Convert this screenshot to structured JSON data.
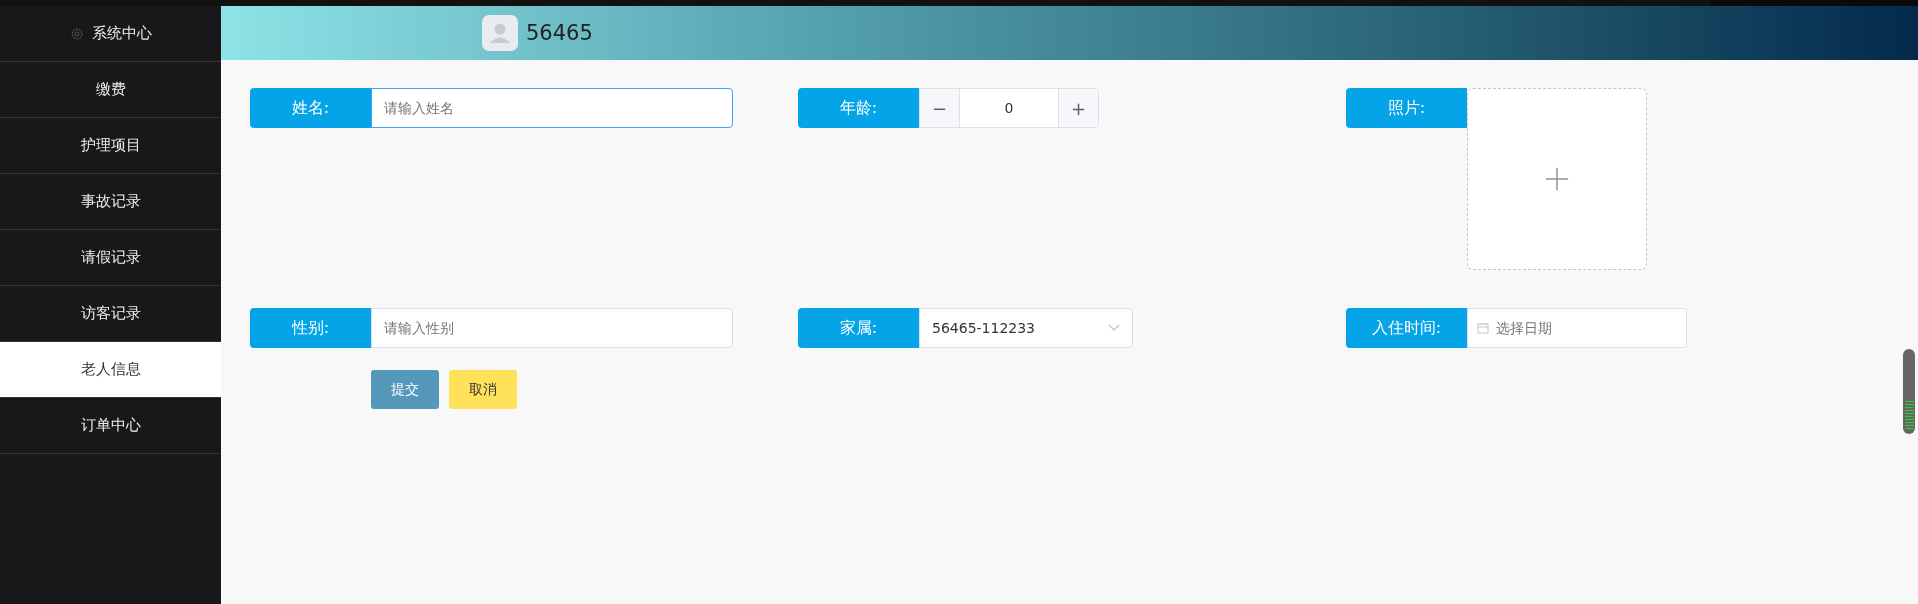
{
  "sidebar": {
    "items": [
      {
        "label": "系统中心",
        "kind": "with_icon",
        "selected": false
      },
      {
        "label": "缴费",
        "selected": false
      },
      {
        "label": "护理项目",
        "selected": false
      },
      {
        "label": "事故记录",
        "selected": false
      },
      {
        "label": "请假记录",
        "selected": false
      },
      {
        "label": "访客记录",
        "selected": false
      },
      {
        "label": "老人信息",
        "selected": true
      },
      {
        "label": "订单中心",
        "selected": false
      }
    ]
  },
  "header": {
    "username": "56465"
  },
  "form": {
    "rows": [
      [
        {
          "kind": "text",
          "label": "姓名:",
          "placeholder": "请输入姓名",
          "focused": true
        },
        {
          "kind": "number",
          "label": "年龄:",
          "value": "0",
          "minus": "−",
          "plus": "+"
        },
        {
          "kind": "upload",
          "label": "照片:"
        }
      ],
      [
        {
          "kind": "text",
          "label": "性别:",
          "placeholder": "请输入性别",
          "focused": false
        },
        {
          "kind": "select",
          "label": "家属:",
          "value": "56465-112233"
        },
        {
          "kind": "date",
          "label": "入住时间:",
          "placeholder": "选择日期"
        }
      ]
    ],
    "buttons": [
      {
        "label": "提交",
        "kind": "primary"
      },
      {
        "label": "取消",
        "kind": "warning"
      }
    ]
  }
}
